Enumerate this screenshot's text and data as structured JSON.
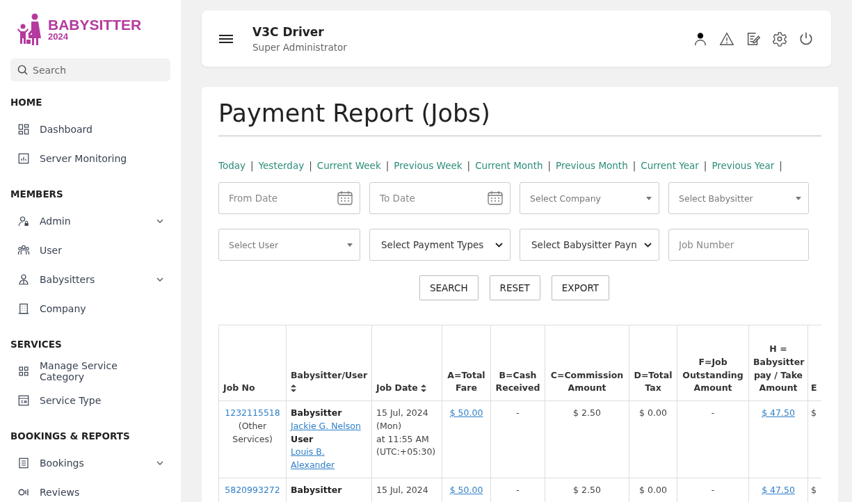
{
  "brand": {
    "name": "BABYSITTER",
    "year": "2024"
  },
  "sidebar": {
    "search": {
      "placeholder": "Search"
    },
    "sections": [
      {
        "title": "HOME",
        "items": [
          {
            "label": "Dashboard",
            "has_submenu": false
          },
          {
            "label": "Server Monitoring",
            "has_submenu": false
          }
        ]
      },
      {
        "title": "MEMBERS",
        "items": [
          {
            "label": "Admin",
            "has_submenu": true
          },
          {
            "label": "User",
            "has_submenu": false
          },
          {
            "label": "Babysitters",
            "has_submenu": true
          },
          {
            "label": "Company",
            "has_submenu": false
          }
        ]
      },
      {
        "title": "SERVICES",
        "items": [
          {
            "label": "Manage Service Category",
            "has_submenu": false
          },
          {
            "label": "Service Type",
            "has_submenu": false
          }
        ]
      },
      {
        "title": "BOOKINGS & REPORTS",
        "items": [
          {
            "label": "Bookings",
            "has_submenu": true
          },
          {
            "label": "Reviews",
            "has_submenu": false
          }
        ]
      }
    ]
  },
  "header": {
    "user_name": "V3C Driver",
    "role": "Super Administrator"
  },
  "page_title": "Payment Report (Jobs)",
  "quick_ranges": [
    {
      "label": "Today",
      "separator": "|"
    },
    {
      "label": "Yesterday",
      "separator": "|"
    },
    {
      "label": "Current Week",
      "separator": "|"
    },
    {
      "label": "Previous Week",
      "separator": "|"
    },
    {
      "label": "Current Month",
      "separator": "|"
    },
    {
      "label": "Previous Month",
      "separator": "|"
    },
    {
      "label": "Current Year",
      "separator": "|"
    },
    {
      "label": "Previous Year",
      "separator": "|"
    }
  ],
  "filters": [
    {
      "kind": "date",
      "placeholder": "From Date"
    },
    {
      "kind": "date",
      "placeholder": "To Date"
    },
    {
      "kind": "combo",
      "placeholder": "Select Company"
    },
    {
      "kind": "combo",
      "placeholder": "Select Babysitter"
    },
    {
      "kind": "combo",
      "placeholder": "Select User"
    },
    {
      "kind": "select",
      "value": "Select Payment Types"
    },
    {
      "kind": "select",
      "value": "Select Babysitter Payn"
    },
    {
      "kind": "text",
      "placeholder": "Job Number"
    }
  ],
  "buttons": [
    "SEARCH",
    "RESET",
    "EXPORT"
  ],
  "table": {
    "columns": [
      {
        "label": "Job No",
        "sortable": false
      },
      {
        "label": "Babysitter/User",
        "sortable": true
      },
      {
        "label": "Job Date",
        "sortable": true
      },
      {
        "label": "A=Total Fare",
        "sortable": false
      },
      {
        "label": "B=Cash Received",
        "sortable": false
      },
      {
        "label": "C=Commission Amount",
        "sortable": false
      },
      {
        "label": "D=Total Tax",
        "sortable": false
      },
      {
        "label": "F=Job Outstanding Amount",
        "sortable": false
      },
      {
        "label": "H = Babysitter pay / Take Amount",
        "sortable": false
      },
      {
        "label": "E",
        "sortable": false
      }
    ],
    "rows": [
      {
        "cells": [
          [
            {
              "kind": "link",
              "text": "1232115518"
            },
            {
              "kind": "text",
              "text": "(Other Services)"
            }
          ],
          [
            {
              "kind": "label",
              "text": "Babysitter"
            },
            {
              "kind": "link",
              "text": "Jackie G. Nelson"
            },
            {
              "kind": "label",
              "text": "User"
            },
            {
              "kind": "link",
              "text": "Louis B. Alexander"
            }
          ],
          [
            {
              "kind": "text",
              "text": "15 Jul, 2024 (Mon)"
            },
            {
              "kind": "text",
              "text": "at 11:55 AM (UTC:+05:30)"
            }
          ],
          [
            {
              "kind": "link",
              "text": "$ 50.00"
            }
          ],
          [
            {
              "kind": "text",
              "text": "-"
            }
          ],
          [
            {
              "kind": "text",
              "text": "$ 2.50"
            }
          ],
          [
            {
              "kind": "text",
              "text": "$ 0.00"
            }
          ],
          [
            {
              "kind": "text",
              "text": "-"
            }
          ],
          [
            {
              "kind": "link",
              "text": "$ 47.50"
            }
          ],
          [
            {
              "kind": "text",
              "text": "$"
            }
          ]
        ]
      },
      {
        "cells": [
          [
            {
              "kind": "link",
              "text": "5820993272"
            }
          ],
          [
            {
              "kind": "label",
              "text": "Babysitter"
            }
          ],
          [
            {
              "kind": "text",
              "text": "15 Jul, 2024"
            }
          ],
          [
            {
              "kind": "link",
              "text": "$ 50.00"
            }
          ],
          [
            {
              "kind": "text",
              "text": "-"
            }
          ],
          [
            {
              "kind": "text",
              "text": "$ 2.50"
            }
          ],
          [
            {
              "kind": "text",
              "text": "$ 0.00"
            }
          ],
          [
            {
              "kind": "text",
              "text": "-"
            }
          ],
          [
            {
              "kind": "link",
              "text": "$ 47.50"
            }
          ],
          [
            {
              "kind": "text",
              "text": "$"
            }
          ]
        ]
      }
    ]
  }
}
